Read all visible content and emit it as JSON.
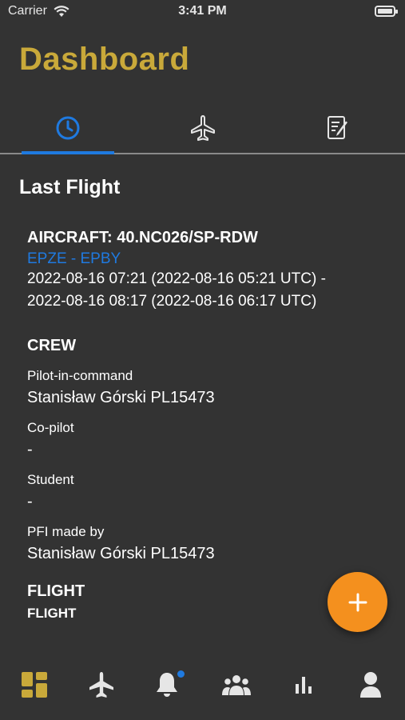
{
  "status_bar": {
    "carrier": "Carrier",
    "time": "3:41 PM"
  },
  "header": {
    "title": "Dashboard"
  },
  "tabs": [
    {
      "icon": "clock-icon",
      "active": true
    },
    {
      "icon": "airplane-icon",
      "active": false
    },
    {
      "icon": "document-edit-icon",
      "active": false
    }
  ],
  "section": {
    "title": "Last Flight"
  },
  "last_flight": {
    "aircraft": "AIRCRAFT: 40.NC026/SP-RDW",
    "route": "EPZE - EPBY",
    "time_line1": "2022-08-16 07:21 (2022-08-16 05:21 UTC) -",
    "time_line2": "2022-08-16 08:17 (2022-08-16 06:17 UTC)",
    "crew_heading": "CREW",
    "crew": [
      {
        "label": "Pilot-in-command",
        "value": "Stanisław Górski PL15473"
      },
      {
        "label": "Co-pilot",
        "value": "-"
      },
      {
        "label": "Student",
        "value": "-"
      },
      {
        "label": "PFI made by",
        "value": "Stanisław Górski PL15473"
      }
    ],
    "flight_heading": "FLIGHT",
    "flight_sub": "FLIGHT"
  },
  "fab": {
    "icon": "plus-icon"
  },
  "bottom_nav": [
    {
      "icon": "dashboard-icon",
      "active": true
    },
    {
      "icon": "airplane-icon",
      "active": false
    },
    {
      "icon": "bell-icon",
      "active": false,
      "badge": true
    },
    {
      "icon": "group-icon",
      "active": false
    },
    {
      "icon": "bar-chart-icon",
      "active": false
    },
    {
      "icon": "user-icon",
      "active": false
    }
  ],
  "colors": {
    "background": "#333333",
    "title": "#c9a93a",
    "accent_blue": "#1f7ae0",
    "fab": "#f4901e",
    "nav_active": "#c9a93a"
  }
}
